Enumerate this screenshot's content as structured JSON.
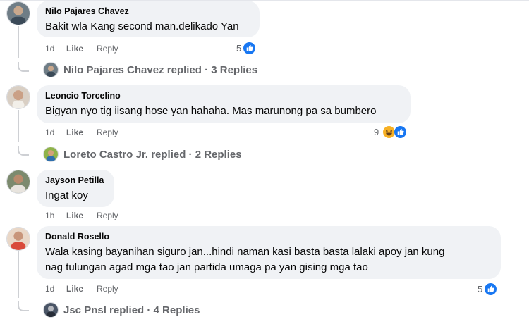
{
  "comments": [
    {
      "author": "Nilo Pajares Chavez",
      "text": "Bakit wla Kang second man.delikado Yan",
      "time": "1d",
      "like_label": "Like",
      "reply_label": "Reply",
      "reaction_count": "5",
      "reactions": [
        "like-icon"
      ],
      "replies_summary": "Nilo Pajares Chavez replied · 3 Replies"
    },
    {
      "author": "Leoncio Torcelino",
      "text": "Bigyan nyo tig iisang hose yan hahaha. Mas marunong pa sa bumbero",
      "time": "1d",
      "like_label": "Like",
      "reply_label": "Reply",
      "reaction_count": "9",
      "reactions": [
        "haha-icon",
        "like-icon"
      ],
      "replies_summary": "Loreto Castro Jr. replied · 2 Replies"
    },
    {
      "author": "Jayson Petilla",
      "text": "Ingat koy",
      "time": "1h",
      "like_label": "Like",
      "reply_label": "Reply"
    },
    {
      "author": "Donald Rosello",
      "text_line1": "Wala kasing bayanihan siguro jan...hindi naman kasi basta basta lalaki apoy jan kung",
      "text_line2": "nag tulungan agad mga tao jan partida umaga pa yan gising mga tao",
      "time": "1d",
      "like_label": "Like",
      "reply_label": "Reply",
      "reaction_count": "5",
      "reactions": [
        "like-icon"
      ],
      "replies_summary": "Jsc Pnsl replied · 4 Replies"
    }
  ],
  "colors": {
    "bubble": "#f0f2f5",
    "meta_text": "#65676b",
    "like_blue": "#1877f2",
    "haha_yellow": "#f7b125"
  }
}
